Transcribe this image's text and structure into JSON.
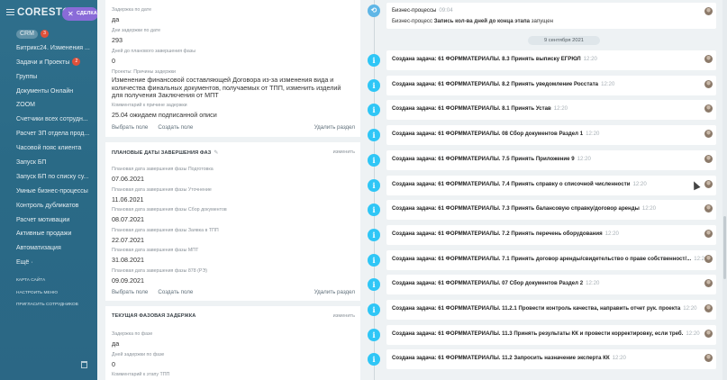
{
  "sidebar": {
    "brand": "CORESTON",
    "deal_button": "СДЕЛКА",
    "crm": {
      "label": "CRM",
      "badge": "3"
    },
    "items": [
      {
        "label": "Битрикс24. Изменения ..."
      },
      {
        "label": "Задачи и Проекты",
        "badge": "2"
      },
      {
        "label": "Группы"
      },
      {
        "label": "Документы Онлайн"
      },
      {
        "label": "ZOOM"
      },
      {
        "label": "Счетчики всех сотрудн..."
      },
      {
        "label": "Расчет ЗП отдела прод..."
      },
      {
        "label": "Часовой пояс клиента"
      },
      {
        "label": "Запуск БП"
      },
      {
        "label": "Запуск БП по списку су..."
      },
      {
        "label": "Умные бизнес-процессы"
      },
      {
        "label": "Контроль дубликатов"
      },
      {
        "label": "Расчет мотивации"
      },
      {
        "label": "Активные продажи"
      },
      {
        "label": "Автоматизация"
      },
      {
        "label": "Ещё ·"
      }
    ],
    "small_links": [
      "КАРТА САЙТА",
      "НАСТРОИТЬ МЕНЮ",
      "ПРИГЛАСИТЬ СОТРУДНИКОВ"
    ]
  },
  "fields": {
    "delay_label": "Задержка по дате",
    "delay_value": "да",
    "days_delay_label": "Дни задержки по дате",
    "days_delay_value": "293",
    "days_to_phase_label": "Дней до планового завершения фазы",
    "days_to_phase_value": "0",
    "reasons_label": "Проекты: Причины задержки",
    "reasons_value": "Изменение финансовой составляющей Договора из-за изменения вида и количества финальных документов, получаемых от ТПП, изменить изделий для получения Заключения от МПТ",
    "comment_label": "Комментарий к причине задержки",
    "comment_value": "25.04 ожидаем подписанной описи",
    "select_field": "Выбрать поле",
    "create_field": "Создать поле",
    "delete_section": "Удалить раздел"
  },
  "planned_dates": {
    "title": "ПЛАНОВЫЕ ДАТЫ ЗАВЕРШЕНИЯ ФАЗ",
    "change": "изменить",
    "rows": [
      {
        "label": "Плановая дата завершения фазы Подготовка",
        "value": "07.06.2021"
      },
      {
        "label": "Плановая дата завершения фазы Уточнение",
        "value": "11.06.2021"
      },
      {
        "label": "Плановая дата завершения фазы Сбор документов",
        "value": "08.07.2021"
      },
      {
        "label": "Плановая дата завершения фазы Заявка в ТПП",
        "value": "22.07.2021"
      },
      {
        "label": "Плановая дата завершения фазы МПТ",
        "value": "31.08.2021"
      },
      {
        "label": "Плановая дата завершения фазы 878 (РЭ)",
        "value": "09.09.2021"
      }
    ],
    "select_field": "Выбрать поле",
    "create_field": "Создать поле",
    "delete_section": "Удалить раздел"
  },
  "current_delay": {
    "title": "ТЕКУЩАЯ ФАЗОВАЯ ЗАДЕРЖКА",
    "change": "изменить",
    "delay_label": "Задержка по фазе",
    "delay_value": "да",
    "days_label": "Дней задержки по фазе",
    "days_value": "0",
    "comment_label": "Комментарий к этапу ТПП"
  },
  "timeline": {
    "bp_title": "Бизнес-процессы",
    "bp_time": "09:04",
    "bp_desc_prefix": "Бизнес-процесс ",
    "bp_desc_bold": "Запись кол-ва дней до конца этапа",
    "bp_desc_suffix": " запущен",
    "date": "9 сентября 2021",
    "prefix": "Создана задача: ",
    "items": [
      {
        "task": "61 ФОРММАТЕРИАЛЫ. 8.3 Принять выписку ЕГРЮЛ",
        "time": "12:20"
      },
      {
        "task": "61 ФОРММАТЕРИАЛЫ. 8.2 Принять уведомление Росстата",
        "time": "12:20"
      },
      {
        "task": "61 ФОРММАТЕРИАЛЫ. 8.1 Принять Устав",
        "time": "12:20"
      },
      {
        "task": "61 ФОРММАТЕРИАЛЫ. 08 Сбор документов Раздел 1",
        "time": "12:20"
      },
      {
        "task": "61 ФОРММАТЕРИАЛЫ. 7.5 Принять Приложение 9",
        "time": "12:20"
      },
      {
        "task": "61 ФОРММАТЕРИАЛЫ. 7.4 Принять справку о списочной численности",
        "time": "12:20"
      },
      {
        "task": "61 ФОРММАТЕРИАЛЫ. 7.3 Принять балансовую справку/договор аренды",
        "time": "12:20"
      },
      {
        "task": "61 ФОРММАТЕРИАЛЫ. 7.2 Принять перечень оборудования",
        "time": "12:20"
      },
      {
        "task": "61 ФОРММАТЕРИАЛЫ. 7.1 Принять договор аренды/свидетельство о праве собственност/...",
        "time": "12:20"
      },
      {
        "task": "61 ФОРММАТЕРИАЛЫ. 07 Сбор документов Раздел 2",
        "time": "12:20"
      },
      {
        "task": "61 ФОРММАТЕРИАЛЫ. 11.2.1 Провести контроль качества, направить отчет рук. проекта",
        "time": "12:20"
      },
      {
        "task": "61 ФОРММАТЕРИАЛЫ. 11.3 Принять результаты КК и провести корректировку, если треб.",
        "time": "12:20"
      },
      {
        "task": "61 ФОРММАТЕРИАЛЫ. 11.2 Запросить назначение эксперта КК",
        "time": "12:20"
      }
    ]
  },
  "colors": {
    "sidebar": "#2f6f8c",
    "accent_icon": "#2fc6f6",
    "deal_button": "#8a6bd8",
    "badge": "#e0503a"
  }
}
